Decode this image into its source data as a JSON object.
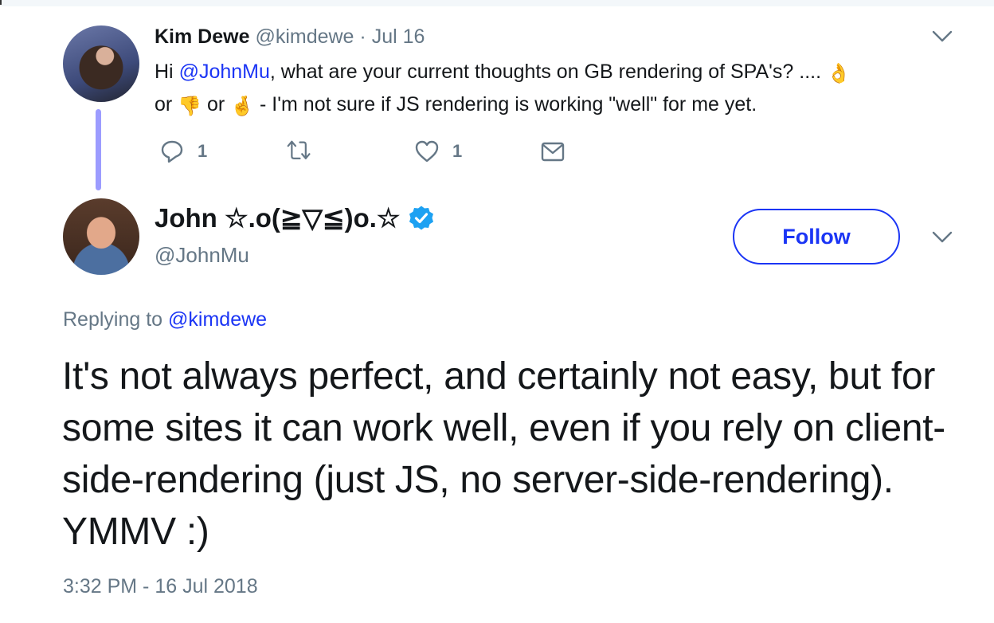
{
  "parent_tweet": {
    "author_name": "Kim Dewe",
    "author_handle": "@kimdewe",
    "separator": " · ",
    "date": "Jul 16",
    "text_parts": {
      "greeting": "Hi ",
      "mention": "@JohnMu",
      "line1_rest": ", what are your current thoughts on GB rendering of SPA's? .... ",
      "emoji_ok": "👌",
      "or1": "or ",
      "emoji_thumbs_down": "👎",
      "or2": " or ",
      "emoji_crossed_fingers": "🤞",
      "line2_rest": " - I'm not sure if JS rendering is working \"well\" for me yet."
    },
    "actions": {
      "reply_count": "1",
      "retweet_count": "",
      "like_count": "1"
    },
    "icons": [
      "avatar",
      "chevron-down-icon",
      "reply-icon",
      "retweet-icon",
      "like-heart-icon",
      "direct-message-icon"
    ]
  },
  "main_tweet": {
    "author_name": "John ☆.o(≧▽≦)o.☆",
    "author_handle": "@JohnMu",
    "verified": true,
    "follow_label": "Follow",
    "replying_prefix": "Replying to ",
    "replying_to": "@kimdewe",
    "text": "It's not always perfect, and certainly not easy, but for some sites it can work well, even if you rely on client-side-rendering (just JS, no server-side-rendering). YMMV :)",
    "timestamp": "3:32 PM - 16 Jul 2018"
  },
  "colors": {
    "link": "#1b35f5",
    "muted": "#657786",
    "thread_line": "#9c9cff",
    "verified": "#1da1f2",
    "text": "#14171a"
  }
}
